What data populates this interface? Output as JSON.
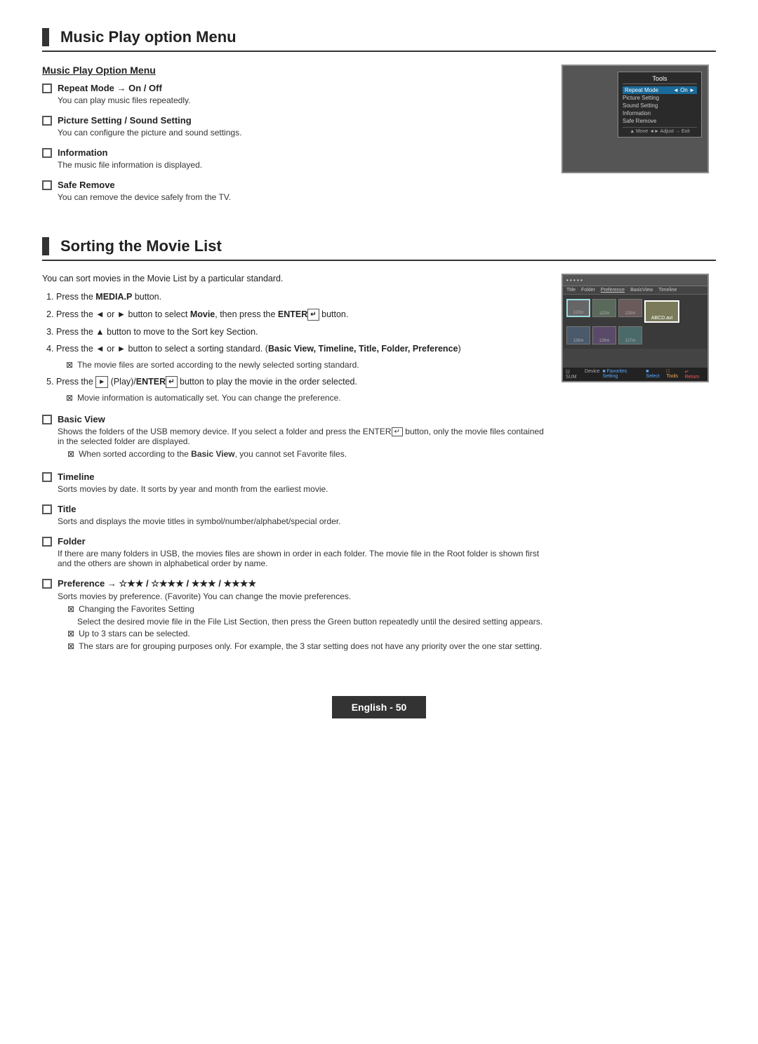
{
  "section1": {
    "title": "Music Play option Menu",
    "subsection_title": "Music Play Option Menu",
    "items": [
      {
        "label": "Repeat Mode → On / Off",
        "desc": "You can play music files repeatedly."
      },
      {
        "label": "Picture Setting / Sound Setting",
        "desc": "You can configure the picture and sound settings."
      },
      {
        "label": "Information",
        "desc": "The music file information is displayed."
      },
      {
        "label": "Safe Remove",
        "desc": "You can remove the device safely from the TV."
      }
    ],
    "tools_title": "Tools",
    "tools_items": [
      {
        "label": "Repeat Mode",
        "value": "On",
        "active": true
      },
      {
        "label": "Picture Setting",
        "value": ""
      },
      {
        "label": "Sound Setting",
        "value": ""
      },
      {
        "label": "Information",
        "value": ""
      },
      {
        "label": "Safe Remove",
        "value": ""
      }
    ],
    "tools_footer": "▲ Move  ◄► Adjust  → Exit"
  },
  "section2": {
    "title": "Sorting the Movie List",
    "intro": "You can sort movies in the Movie List by a particular standard.",
    "steps": [
      "Press the <b>MEDIA.P</b> button.",
      "Press the ◄ or ► button to select <b>Movie</b>, then press the <b>ENTER</b> button.",
      "Press the ▲ button to move to the Sort key Section.",
      "Press the ◄ or ► button to select a sorting standard. (<b>Basic View, Timeline, Title, Folder, Preference</b>)",
      "Press the [►] (Play)/<b>ENTER</b> button to play the movie in the order selected."
    ],
    "step_notes": [
      "The movie files are sorted according to the newly selected sorting standard.",
      "Movie information is automatically set. You can change the preference."
    ],
    "check_items": [
      {
        "label": "Basic View",
        "desc": "Shows the folders of the USB memory device. If you select a folder and press the ENTER button, only the movie files contained in the selected folder are displayed.",
        "note": "When sorted according to the Basic View, you cannot set Favorite files."
      },
      {
        "label": "Timeline",
        "desc": "Sorts movies by date. It sorts by year and month from the earliest movie.",
        "note": null
      },
      {
        "label": "Title",
        "desc": "Sorts and displays the movie titles in symbol/number/alphabet/special order.",
        "note": null
      },
      {
        "label": "Folder",
        "desc": "If there are many folders in USB, the movies files are shown in order in each folder. The movie file in the Root folder is shown first and the others are shown in alphabetical order by name.",
        "note": null
      },
      {
        "label": "Preference → ☆★★ / ☆★★★ / ★★★ / ★★★★",
        "label_plain": "Preference",
        "desc": "Sorts movies by preference. (Favorite) You can change the movie preferences.",
        "note": null,
        "sub_notes": [
          "Changing the Favorites Setting",
          "Select the desired movie file in the File List Section, then press the Green button repeatedly until the desired setting appears.",
          "Up to 3 stars can be selected.",
          "The stars are for grouping purposes only. For example, the 3 star setting does not have any priority over the one star setting."
        ]
      }
    ],
    "movie_header_tabs": [
      "Title",
      "Folder",
      "Preference",
      "BasicView",
      "Timeline"
    ],
    "movie_footer_items": [
      "SUM  Device",
      "Favorites Setting",
      "Select",
      "Tools",
      "Return"
    ]
  },
  "footer": {
    "label": "English - 50"
  }
}
